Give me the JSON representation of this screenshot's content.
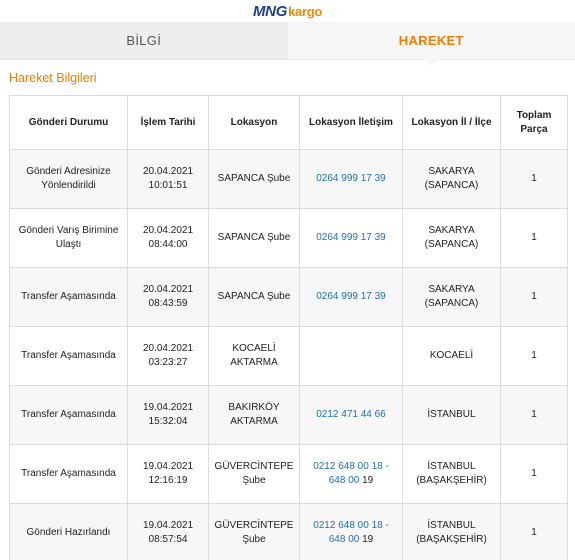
{
  "brand": {
    "logo_main": "MNG",
    "logo_sub": "kargo",
    "primary_color": "#1b3f8f",
    "accent_color": "#f07c00"
  },
  "tabs": [
    {
      "label": "BİLGİ",
      "active": false
    },
    {
      "label": "HAREKET",
      "active": true
    }
  ],
  "section_title": "Hareket Bilgileri",
  "table": {
    "headers": [
      "Gönderi Durumu",
      "İşlem Tarihi",
      "Lokasyon",
      "Lokasyon İletişim",
      "Lokasyon İl / İlçe",
      "Toplam Parça"
    ],
    "rows": [
      {
        "status": "Gönderi Adresinize Yönlendirildi",
        "date": "20.04.2021",
        "time": "10:01:51",
        "location": "SAPANCA Şube",
        "phone": "0264 999 17 39",
        "phone_tail": "",
        "city": "SAKARYA",
        "district": "(SAPANCA)",
        "pieces": "1"
      },
      {
        "status": "Gönderi Varış Birimine Ulaştı",
        "date": "20.04.2021",
        "time": "08:44:00",
        "location": "SAPANCA Şube",
        "phone": "0264 999 17 39",
        "phone_tail": "",
        "city": "SAKARYA",
        "district": "(SAPANCA)",
        "pieces": "1"
      },
      {
        "status": "Transfer Aşamasında",
        "date": "20.04.2021",
        "time": "08:43:59",
        "location": "SAPANCA Şube",
        "phone": "0264 999 17 39",
        "phone_tail": "",
        "city": "SAKARYA",
        "district": "(SAPANCA)",
        "pieces": "1"
      },
      {
        "status": "Transfer Aşamasında",
        "date": "20.04.2021",
        "time": "03:23:27",
        "location": "KOCAELİ AKTARMA",
        "phone": "",
        "phone_tail": "",
        "city": "KOCAELİ",
        "district": "",
        "pieces": "1"
      },
      {
        "status": "Transfer Aşamasında",
        "date": "19.04.2021",
        "time": "15:32:04",
        "location": "BAKIRKÖY AKTARMA",
        "phone": "0212 471 44 66",
        "phone_tail": "",
        "city": "İSTANBUL",
        "district": "",
        "pieces": "1"
      },
      {
        "status": "Transfer Aşamasında",
        "date": "19.04.2021",
        "time": "12:16:19",
        "location": "GÜVERCİNTEPE Şube",
        "phone": "0212 648 00 18 - 648 00",
        "phone_tail": " 19",
        "city": "İSTANBUL",
        "district": "(BAŞAKŞEHİR)",
        "pieces": "1"
      },
      {
        "status": "Gönderi Hazırlandı",
        "date": "19.04.2021",
        "time": "08:57:54",
        "location": "GÜVERCİNTEPE Şube",
        "phone": "0212 648 00 18 - 648 00",
        "phone_tail": " 19",
        "city": "İSTANBUL",
        "district": "(BAŞAKŞEHİR)",
        "pieces": "1"
      }
    ]
  }
}
